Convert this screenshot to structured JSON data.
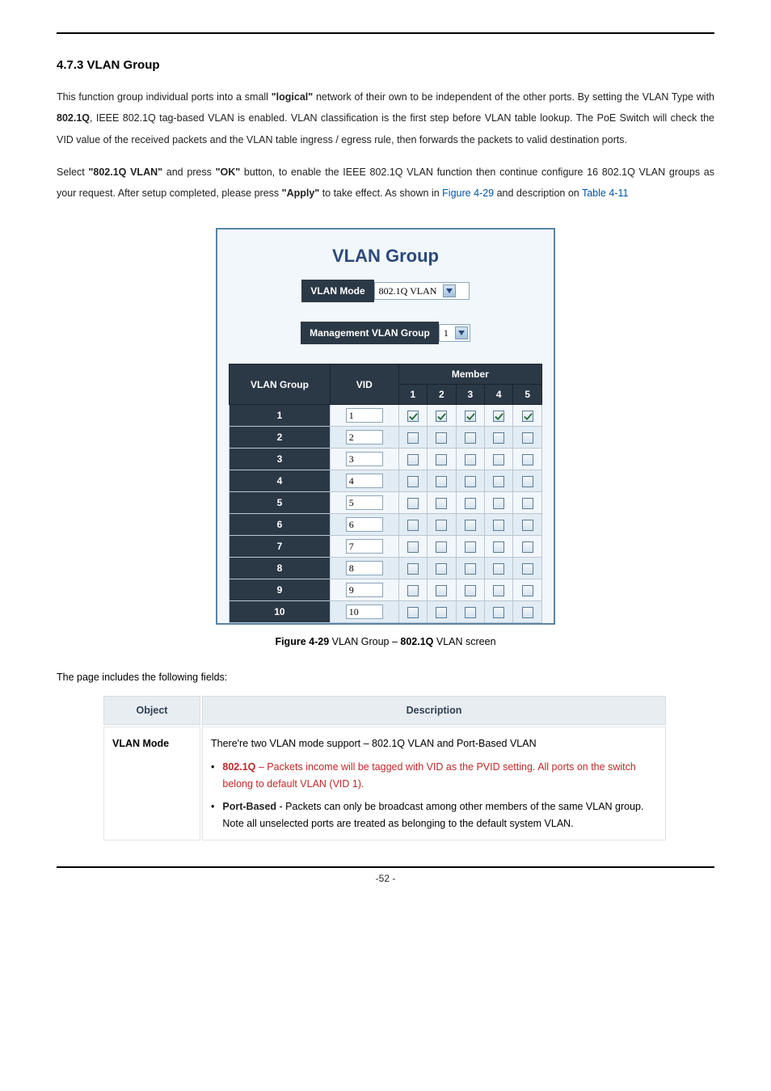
{
  "section_heading": "4.7.3 VLAN Group",
  "para1": {
    "t1": "This function group individual ports into a small ",
    "t2": "\"logical\" ",
    "t3": "network of their own to be independent of the other ports. By setting the VLAN Type with ",
    "t4": "802.1Q",
    "t5": ", IEEE 802.1Q tag-based VLAN is enabled. VLAN classification is the first step before VLAN table lookup. The PoE Switch will check the VID value of the received packets and the VLAN table ingress / egress rule, then forwards the packets to valid destination ports."
  },
  "para2": {
    "t1": "Select ",
    "t2": "\"802.1Q VLAN\"",
    "t3": " and press ",
    "t4": "\"OK\" ",
    "t5": "button, to enable the IEEE 802.1Q VLAN function then continue configure 16 802.1Q VLAN groups as your request. After setup completed, please press ",
    "t6": "\"Apply\"",
    "t7": " to take effect. As shown in ",
    "link1": "Figure 4-29",
    "t8": " and description on ",
    "link2": "Table 4-11"
  },
  "screenshot": {
    "title": "VLAN Group",
    "mode_label": "VLAN Mode",
    "mode_value": "802.1Q VLAN",
    "mgmt_label": "Management VLAN Group",
    "mgmt_value": "1",
    "col_group": "VLAN Group",
    "col_vid": "VID",
    "col_member": "Member",
    "member_cols": [
      "1",
      "2",
      "3",
      "4",
      "5"
    ],
    "rows": [
      {
        "group": "1",
        "vid": "1",
        "members": [
          true,
          true,
          true,
          true,
          true
        ]
      },
      {
        "group": "2",
        "vid": "2",
        "members": [
          false,
          false,
          false,
          false,
          false
        ]
      },
      {
        "group": "3",
        "vid": "3",
        "members": [
          false,
          false,
          false,
          false,
          false
        ]
      },
      {
        "group": "4",
        "vid": "4",
        "members": [
          false,
          false,
          false,
          false,
          false
        ]
      },
      {
        "group": "5",
        "vid": "5",
        "members": [
          false,
          false,
          false,
          false,
          false
        ]
      },
      {
        "group": "6",
        "vid": "6",
        "members": [
          false,
          false,
          false,
          false,
          false
        ]
      },
      {
        "group": "7",
        "vid": "7",
        "members": [
          false,
          false,
          false,
          false,
          false
        ]
      },
      {
        "group": "8",
        "vid": "8",
        "members": [
          false,
          false,
          false,
          false,
          false
        ]
      },
      {
        "group": "9",
        "vid": "9",
        "members": [
          false,
          false,
          false,
          false,
          false
        ]
      },
      {
        "group": "10",
        "vid": "10",
        "members": [
          false,
          false,
          false,
          false,
          false
        ]
      }
    ]
  },
  "figure_caption": {
    "prefix": "Figure 4-29 ",
    "mid": "VLAN Group – ",
    "emph": "802.1Q",
    "suffix": " VLAN screen"
  },
  "fields_lead": "The page includes the following fields:",
  "field_table": {
    "head_object": "Object",
    "head_desc": "Description",
    "row1": {
      "object": "VLAN Mode",
      "line1": "There're two VLAN mode support – 802.1Q VLAN and Port-Based VLAN",
      "bullet1_key": "802.1Q",
      "bullet1_rest": " – Packets income will be tagged with VID as the PVID setting. All ports on the switch belong to default VLAN (VID 1).",
      "bullet2_key": "Port-Based",
      "bullet2_rest": " - Packets can only be broadcast among other members of the same VLAN group. Note all unselected ports are treated as belonging to the default system VLAN."
    }
  },
  "page_number": "-52 -"
}
